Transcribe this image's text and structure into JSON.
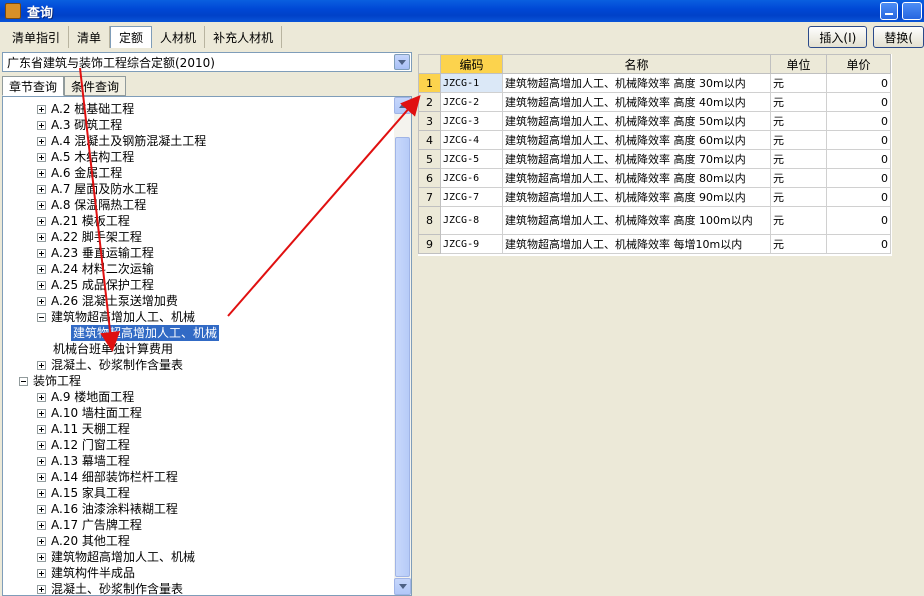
{
  "window": {
    "title": "查询"
  },
  "tabs": [
    {
      "label": "清单指引"
    },
    {
      "label": "清单"
    },
    {
      "label": "定额"
    },
    {
      "label": "人材机"
    },
    {
      "label": "补充人材机"
    }
  ],
  "actions": {
    "insert": "插入(I)",
    "replace": "替换("
  },
  "quota_select": {
    "value": "广东省建筑与装饰工程综合定额(2010)"
  },
  "subtabs": {
    "chapter": "章节查询",
    "condition": "条件查询"
  },
  "tree": [
    {
      "label": "A.2 桩基础工程"
    },
    {
      "label": "A.3 砌筑工程"
    },
    {
      "label": "A.4 混凝土及钢筋混凝土工程"
    },
    {
      "label": "A.5 木结构工程"
    },
    {
      "label": "A.6 金属工程"
    },
    {
      "label": "A.7 屋面及防水工程"
    },
    {
      "label": "A.8 保温隔热工程"
    },
    {
      "label": "A.21 模板工程"
    },
    {
      "label": "A.22 脚手架工程"
    },
    {
      "label": "A.23 垂直运输工程"
    },
    {
      "label": "A.24 材料二次运输"
    },
    {
      "label": "A.25 成品保护工程"
    },
    {
      "label": "A.26 混凝土泵送增加费"
    },
    {
      "label": "建筑物超高增加人工、机械"
    },
    {
      "label": "建筑物超高增加人工、机械"
    },
    {
      "label": "机械台班单独计算费用"
    },
    {
      "label": "混凝土、砂浆制作含量表"
    },
    {
      "label": "装饰工程"
    },
    {
      "label": "A.9 楼地面工程"
    },
    {
      "label": "A.10 墙柱面工程"
    },
    {
      "label": "A.11 天棚工程"
    },
    {
      "label": "A.12 门窗工程"
    },
    {
      "label": "A.13 幕墙工程"
    },
    {
      "label": "A.14 细部装饰栏杆工程"
    },
    {
      "label": "A.15 家具工程"
    },
    {
      "label": "A.16 油漆涂料裱糊工程"
    },
    {
      "label": "A.17 广告牌工程"
    },
    {
      "label": "A.20 其他工程"
    },
    {
      "label": "建筑物超高增加人工、机械"
    },
    {
      "label": "建筑构件半成品"
    },
    {
      "label": "混凝土、砂浆制作含量表"
    }
  ],
  "grid": {
    "headers": {
      "code": "编码",
      "name": "名称",
      "unit": "单位",
      "price": "单价"
    },
    "rows": [
      {
        "n": "1",
        "code": "JZCG-1",
        "name": "建筑物超高增加人工、机械降效率 高度 30m以内",
        "unit": "元",
        "price": "0"
      },
      {
        "n": "2",
        "code": "JZCG-2",
        "name": "建筑物超高增加人工、机械降效率 高度 40m以内",
        "unit": "元",
        "price": "0"
      },
      {
        "n": "3",
        "code": "JZCG-3",
        "name": "建筑物超高增加人工、机械降效率 高度 50m以内",
        "unit": "元",
        "price": "0"
      },
      {
        "n": "4",
        "code": "JZCG-4",
        "name": "建筑物超高增加人工、机械降效率 高度 60m以内",
        "unit": "元",
        "price": "0"
      },
      {
        "n": "5",
        "code": "JZCG-5",
        "name": "建筑物超高增加人工、机械降效率 高度 70m以内",
        "unit": "元",
        "price": "0"
      },
      {
        "n": "6",
        "code": "JZCG-6",
        "name": "建筑物超高增加人工、机械降效率 高度 80m以内",
        "unit": "元",
        "price": "0"
      },
      {
        "n": "7",
        "code": "JZCG-7",
        "name": "建筑物超高增加人工、机械降效率 高度 90m以内",
        "unit": "元",
        "price": "0"
      },
      {
        "n": "8",
        "code": "JZCG-8",
        "name": "建筑物超高增加人工、机械降效率 高度 100m以内",
        "unit": "元",
        "price": "0"
      },
      {
        "n": "9",
        "code": "JZCG-9",
        "name": "建筑物超高增加人工、机械降效率 每增10m以内",
        "unit": "元",
        "price": "0"
      }
    ]
  },
  "colors": {
    "selection": "#316ac5",
    "header_highlight": "#fcd34d",
    "annotation": "#e01010"
  }
}
